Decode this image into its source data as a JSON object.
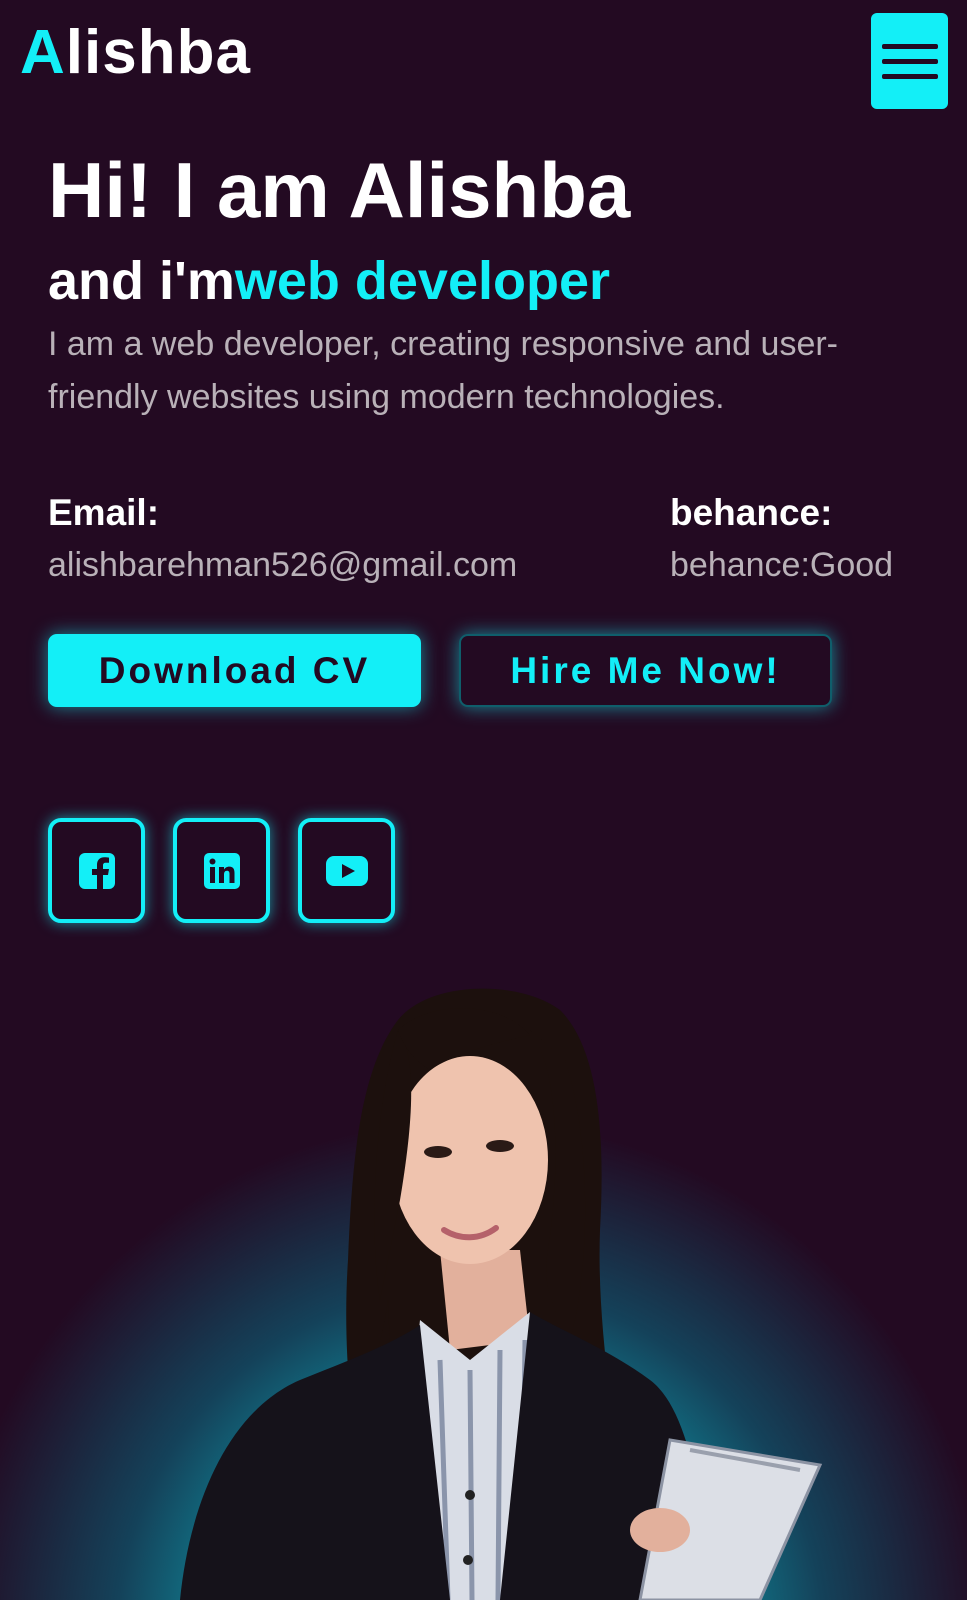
{
  "header": {
    "logo_initial": "A",
    "logo_rest": "lishba",
    "menu_icon": "hamburger-menu-icon"
  },
  "hero": {
    "title": "Hi! I am Alishba",
    "subtitle_prefix": "and i'm",
    "subtitle_role": "web developer",
    "description": "I am a web developer, creating responsive and user-friendly websites using modern technologies."
  },
  "contact": {
    "email_label": "Email:",
    "email_value": "alishbarehman526@gmail.com",
    "behance_label": "behance:",
    "behance_value": "behance:Good"
  },
  "buttons": {
    "download_cv": "Download CV",
    "hire_me": "Hire Me Now!"
  },
  "social": [
    {
      "icon": "facebook-icon"
    },
    {
      "icon": "linkedin-icon"
    },
    {
      "icon": "youtube-icon"
    }
  ],
  "colors": {
    "background": "#230a22",
    "accent": "#13eff7",
    "muted_text": "#b9b1b8"
  }
}
